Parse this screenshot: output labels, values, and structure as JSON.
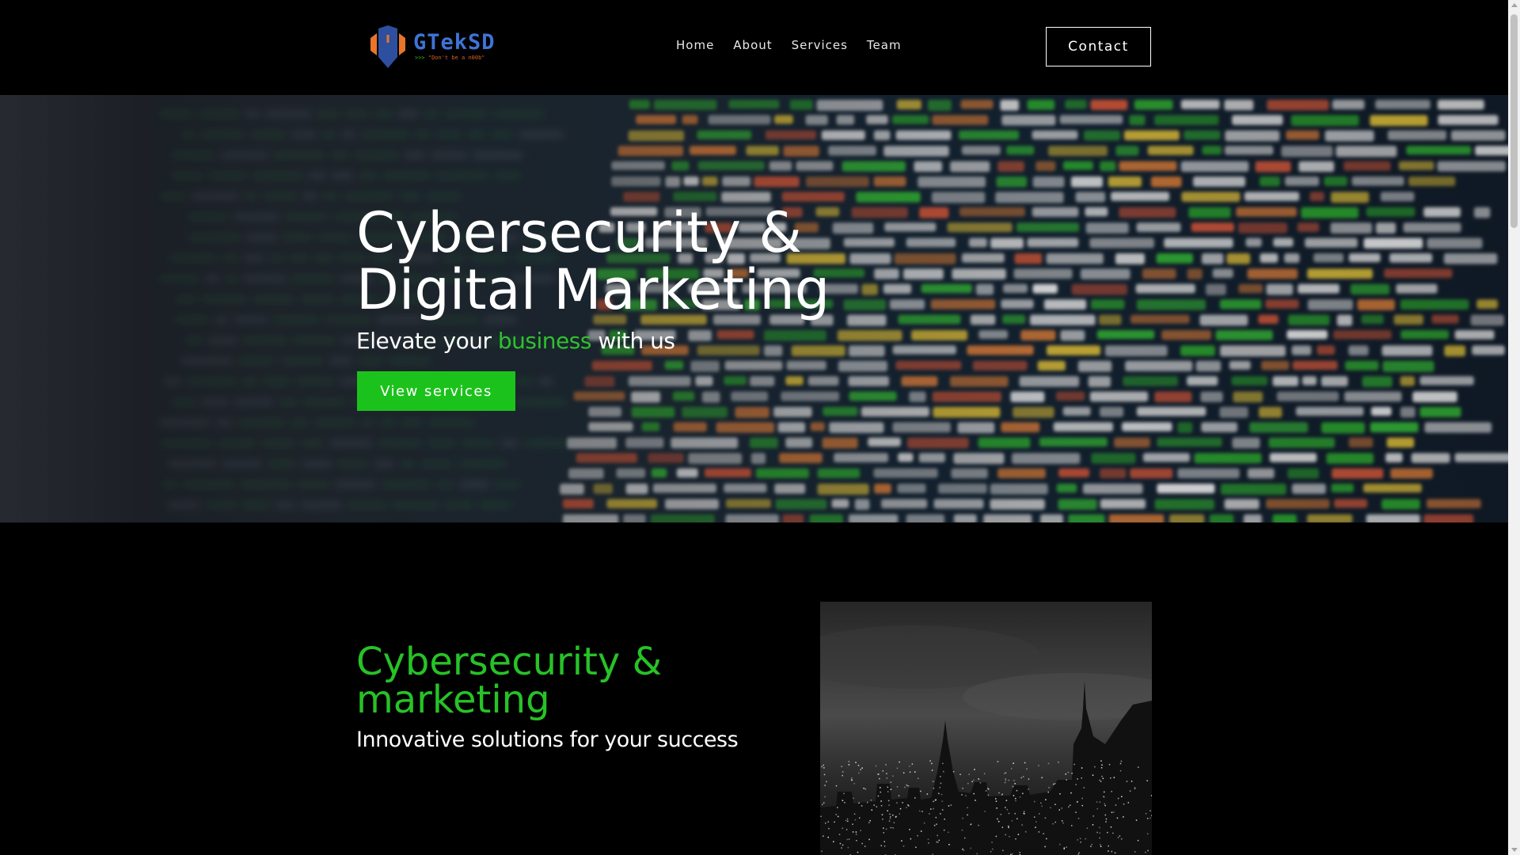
{
  "header": {
    "logo": {
      "name": "GTekSD",
      "tagline_prefix": ">>>",
      "tagline": "\"Don't be a n00b\"",
      "icon": "shield-shell-icon"
    },
    "nav": [
      {
        "label": "Home"
      },
      {
        "label": "About"
      },
      {
        "label": "Services"
      },
      {
        "label": "Team"
      }
    ],
    "contact_label": "Contact"
  },
  "hero": {
    "title_line1": "Cybersecurity &",
    "title_line2": "Digital Marketing",
    "subtitle_before": "Elevate your ",
    "subtitle_highlight": "business",
    "subtitle_after": " with us",
    "button_label": "View services",
    "background": "code-on-screen-photo"
  },
  "section2": {
    "title_line1": "Cybersecurity &",
    "title_line2": "marketing",
    "subtitle": "Innovative solutions for your success",
    "image": "night-city-skyline-photo"
  },
  "colors": {
    "accent_green": "#1cc21c",
    "logo_blue": "#3f73d6",
    "logo_orange": "#e8752a",
    "background": "#000000"
  }
}
